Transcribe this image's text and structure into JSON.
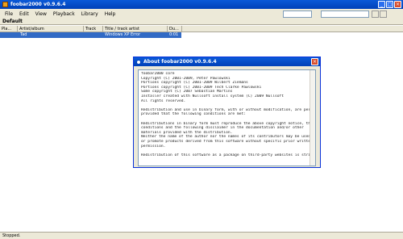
{
  "window": {
    "title": "foobar2000 v0.9.6.4",
    "minimize": "_",
    "maximize": "□",
    "close": "×"
  },
  "menu": [
    "File",
    "Edit",
    "View",
    "Playback",
    "Library",
    "Help"
  ],
  "toolbar": {
    "playlist_tab": "Default"
  },
  "columns": [
    "Pla...",
    "Artist/album",
    "Track",
    "Title / track artist",
    "Du..."
  ],
  "playlist": [
    {
      "playing": "",
      "artist": "Tad",
      "track": "",
      "title": "Windows XP Error",
      "duration": "0:01"
    }
  ],
  "status": {
    "text": "Stopped."
  },
  "dialog": {
    "title": "About foobar2000 v0.9.6.4",
    "close": "×",
    "lines": [
      "foobar2000 core",
      "Copyright (C) 2001-2009, Peter Pawlowski",
      "Portions copyright (C) 2001-2009 Wilbert Ziemans",
      "Portions copyright (C) 2001-2009 Tech Clarke Pawlowski",
      "Some copyright (C) 2007 Sebastian Martins",
      "Installer created with Nullsoft install system (C) 2009 Nullsoft",
      "All rights reserved.",
      "",
      "Redistribution and use in binary form, with or without modification, are permitted",
      "provided that the following conditions are met:",
      "",
      "Redistributions in binary form must reproduce the above copyright notice, this list of",
      "conditions and the following disclaimer in the documentation and/or other",
      "materials provided with the distribution.",
      "Neither the name of the author nor the names of its contributors may be used to endorse",
      "or promote products derived from this software without specific prior written",
      "permission.",
      "",
      "Redistribution of this software as a package on third-party websites is strictly"
    ]
  }
}
